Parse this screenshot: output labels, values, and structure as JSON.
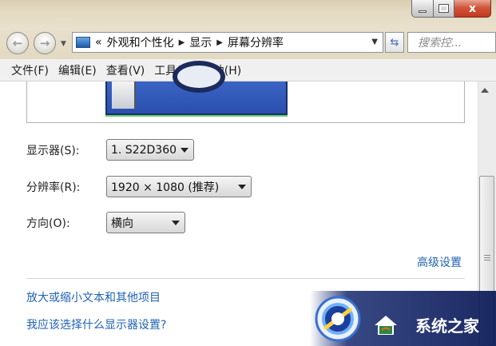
{
  "window": {
    "caption": {
      "close_symbol": "x"
    }
  },
  "navigation": {
    "back_symbol": "←",
    "forward_symbol": "→",
    "overflow_symbol": "«",
    "breadcrumbs": [
      "外观和个性化",
      "显示",
      "屏幕分辨率"
    ],
    "search_placeholder": "搜索控..."
  },
  "menubar": {
    "items": [
      "文件(F)",
      "编辑(E)",
      "查看(V)",
      "工具(T)",
      "帮助(H)"
    ]
  },
  "settings": {
    "display": {
      "label": "显示器(S):",
      "value": "1. S22D360"
    },
    "resolution": {
      "label": "分辨率(R):",
      "value": "1920 × 1080 (推荐)"
    },
    "orientation": {
      "label": "方向(O):",
      "value": "横向"
    },
    "advanced_link": "高级设置"
  },
  "links": {
    "text_size": "放大或缩小文本和其他项目",
    "help": "我应该选择什么显示器设置?"
  },
  "watermark": {
    "text": "系统之家"
  },
  "colors": {
    "link": "#1f62b4",
    "monitor_blue": "#2a4fae",
    "close_red": "#c2391f"
  }
}
